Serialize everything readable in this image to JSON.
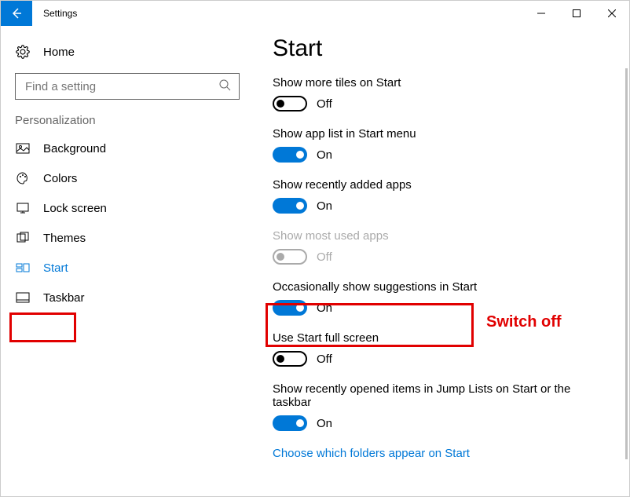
{
  "titlebar": {
    "title": "Settings"
  },
  "sidebar": {
    "home_label": "Home",
    "search_placeholder": "Find a setting",
    "section_label": "Personalization",
    "items": [
      {
        "label": "Background"
      },
      {
        "label": "Colors"
      },
      {
        "label": "Lock screen"
      },
      {
        "label": "Themes"
      },
      {
        "label": "Start"
      },
      {
        "label": "Taskbar"
      }
    ]
  },
  "page": {
    "title": "Start",
    "settings": [
      {
        "label": "Show more tiles on Start",
        "state": "off",
        "state_text": "Off"
      },
      {
        "label": "Show app list in Start menu",
        "state": "on",
        "state_text": "On"
      },
      {
        "label": "Show recently added apps",
        "state": "on",
        "state_text": "On"
      },
      {
        "label": "Show most used apps",
        "state": "disabled-off",
        "state_text": "Off"
      },
      {
        "label": "Occasionally show suggestions in Start",
        "state": "on",
        "state_text": "On"
      },
      {
        "label": "Use Start full screen",
        "state": "off",
        "state_text": "Off"
      },
      {
        "label": "Show recently opened items in Jump Lists on Start or the taskbar",
        "state": "on",
        "state_text": "On"
      }
    ],
    "link_text": "Choose which folders appear on Start"
  },
  "annotation": {
    "text": "Switch off"
  }
}
